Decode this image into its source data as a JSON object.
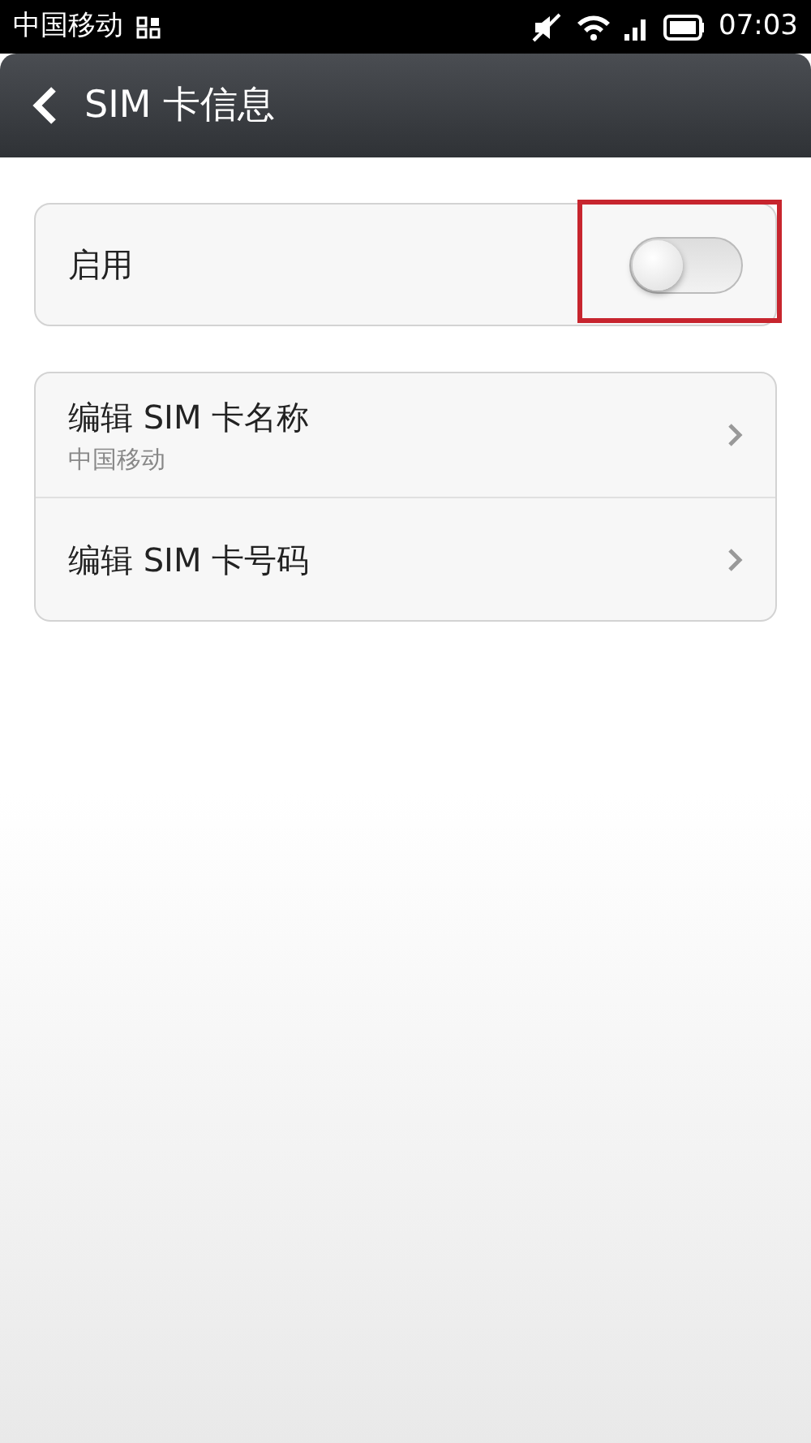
{
  "status_bar": {
    "carrier": "中国移动",
    "time": "07:03"
  },
  "header": {
    "title": "SIM 卡信息"
  },
  "enable_card": {
    "label": "启用",
    "on": false
  },
  "items": [
    {
      "title": "编辑 SIM 卡名称",
      "subtitle": "中国移动"
    },
    {
      "title": "编辑 SIM 卡号码"
    }
  ]
}
